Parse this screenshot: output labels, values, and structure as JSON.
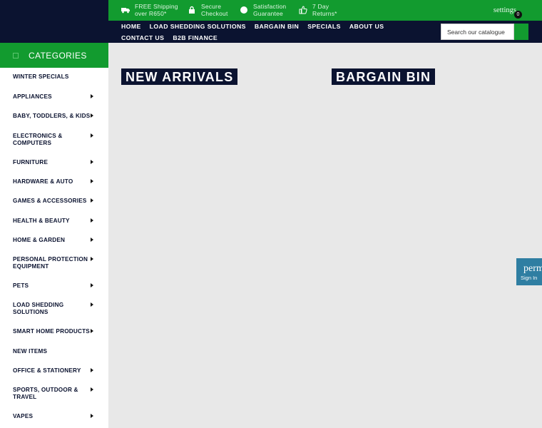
{
  "topbar": {
    "features": [
      {
        "icon": "truck-icon",
        "line1": "FREE Shipping",
        "line2": "over R650*"
      },
      {
        "icon": "lock-icon",
        "line1": "Secure",
        "line2": "Checkout"
      },
      {
        "icon": "badge-icon",
        "line1": "Satisfaction",
        "line2": "Guarantee"
      },
      {
        "icon": "thumbs-up-icon",
        "line1": "7 Day",
        "line2": "Returns*"
      }
    ],
    "settings_label": "settings",
    "cart_count": "0"
  },
  "nav": {
    "row1": [
      "HOME",
      "LOAD SHEDDING SOLUTIONS",
      "BARGAIN BIN",
      "SPECIALS",
      "ABOUT US"
    ],
    "row2": [
      "CONTACT US",
      "B2B FINANCE"
    ]
  },
  "search": {
    "placeholder": "Search our catalogue"
  },
  "sidebar": {
    "title": "CATEGORIES",
    "items": [
      {
        "label": "WINTER SPECIALS",
        "has_children": false
      },
      {
        "label": "APPLIANCES",
        "has_children": true
      },
      {
        "label": "BABY, TODDLERS, & KIDS",
        "has_children": true
      },
      {
        "label": "ELECTRONICS & COMPUTERS",
        "has_children": true
      },
      {
        "label": "FURNITURE",
        "has_children": true
      },
      {
        "label": "HARDWARE & AUTO",
        "has_children": true
      },
      {
        "label": "GAMES & ACCESSORIES",
        "has_children": true
      },
      {
        "label": "HEALTH & BEAUTY",
        "has_children": true
      },
      {
        "label": "HOME & GARDEN",
        "has_children": true
      },
      {
        "label": "PERSONAL PROTECTION EQUIPMENT",
        "has_children": true
      },
      {
        "label": "PETS",
        "has_children": true
      },
      {
        "label": "LOAD SHEDDING SOLUTIONS",
        "has_children": true
      },
      {
        "label": "SMART HOME PRODUCTS",
        "has_children": true
      },
      {
        "label": "NEW ITEMS",
        "has_children": false
      },
      {
        "label": "OFFICE & STATIONERY",
        "has_children": true
      },
      {
        "label": "SPORTS, OUTDOOR & TRAVEL",
        "has_children": true
      },
      {
        "label": "VAPES",
        "has_children": true
      }
    ]
  },
  "sections": {
    "new_arrivals": "NEW ARRIVALS",
    "bargain_bin": "BARGAIN BIN"
  },
  "widget": {
    "line1": "perm",
    "line2": "Sign In"
  },
  "colors": {
    "green": "#129b2f",
    "navy": "#0b1330",
    "widget_blue": "#2f7ea2"
  }
}
